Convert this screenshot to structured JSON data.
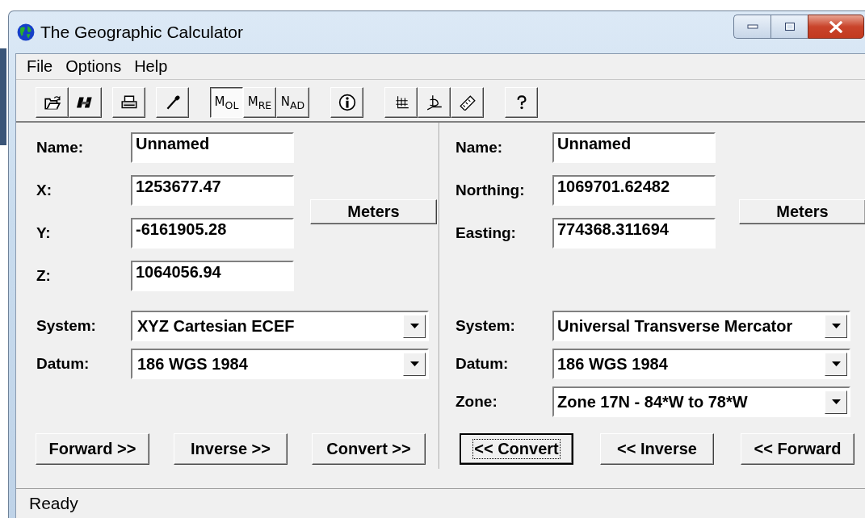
{
  "window": {
    "title": "The Geographic Calculator"
  },
  "menu": [
    "File",
    "Options",
    "Help"
  ],
  "toolbar": {
    "mode_buttons": [
      {
        "label": "M$_{OL}$",
        "selected": true
      },
      {
        "label": "M$_{RE}$",
        "selected": false
      },
      {
        "label": "N$_{AD}$",
        "selected": false
      }
    ]
  },
  "left_panel": {
    "fields": [
      {
        "label": "Name:",
        "value": "Unnamed"
      },
      {
        "label": "X:",
        "value": "1253677.47"
      },
      {
        "label": "Y:",
        "value": "-6161905.28"
      },
      {
        "label": "Z:",
        "value": "1064056.94"
      }
    ],
    "units_button": "Meters",
    "dropdowns": [
      {
        "label": "System:",
        "value": "XYZ Cartesian ECEF"
      },
      {
        "label": "Datum:",
        "value": "186  WGS 1984"
      }
    ],
    "buttons": [
      {
        "label": "Forward >>",
        "focused": false
      },
      {
        "label": "Inverse >>",
        "focused": false
      },
      {
        "label": "Convert >>",
        "focused": false
      }
    ]
  },
  "right_panel": {
    "fields": [
      {
        "label": "Name:",
        "value": "Unnamed"
      },
      {
        "label": "Northing:",
        "value": "1069701.62482"
      },
      {
        "label": "Easting:",
        "value": "774368.311694"
      }
    ],
    "units_button": "Meters",
    "dropdowns": [
      {
        "label": "System:",
        "value": "Universal Transverse Mercator"
      },
      {
        "label": "Datum:",
        "value": "186  WGS 1984"
      },
      {
        "label": "Zone:",
        "value": "Zone 17N - 84*W to 78*W"
      }
    ],
    "buttons": [
      {
        "label": "<< Convert",
        "focused": true
      },
      {
        "label": "<< Inverse",
        "focused": false
      },
      {
        "label": "<< Forward",
        "focused": false
      }
    ]
  },
  "status_bar": "Ready"
}
